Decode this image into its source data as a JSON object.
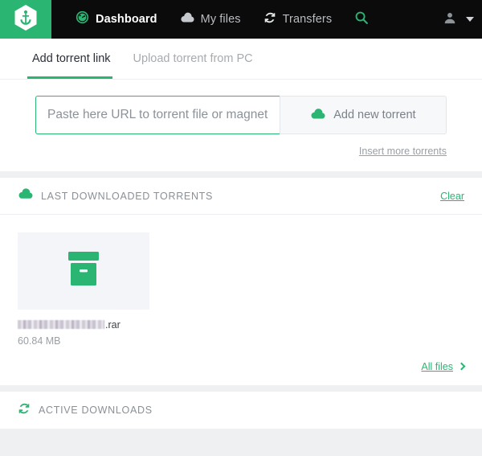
{
  "colors": {
    "accent_green": "#2ab573",
    "nav_background": "#0b0b0b",
    "page_background": "#eef0f2",
    "card_background": "#ffffff",
    "muted_text": "#9aa0a6"
  },
  "topbar": {
    "logo_icon": "anchor-hexagon-logo",
    "items": [
      {
        "label": "Dashboard",
        "icon": "speedometer-icon",
        "active": true
      },
      {
        "label": "My files",
        "icon": "cloud-icon",
        "active": false
      },
      {
        "label": "Transfers",
        "icon": "sync-arrows-icon",
        "active": false
      }
    ],
    "search_icon": "search-icon",
    "account_icon": "user-avatar-icon",
    "account_caret_icon": "chevron-down-icon"
  },
  "tabs": [
    {
      "label": "Add torrent link",
      "active": true
    },
    {
      "label": "Upload torrent from PC",
      "active": false
    }
  ],
  "add_torrent": {
    "input_placeholder": "Paste here URL to torrent file or magnet link.",
    "input_value": "",
    "button_label": "Add new torrent",
    "button_icon": "cloud-upload-icon",
    "insert_more_label": "Insert more torrents"
  },
  "last_downloaded": {
    "icon": "cloud-icon",
    "title": "LAST DOWNLOADED TORRENTS",
    "clear_label": "Clear",
    "files": [
      {
        "thumb_icon": "archive-box-icon",
        "name_redacted": true,
        "name_suffix": ".rar",
        "size": "60.84 MB"
      }
    ],
    "all_files_label": "All files",
    "all_files_icon": "chevron-right-icon"
  },
  "active_downloads": {
    "icon": "sync-arrows-icon",
    "title": "ACTIVE DOWNLOADS"
  }
}
